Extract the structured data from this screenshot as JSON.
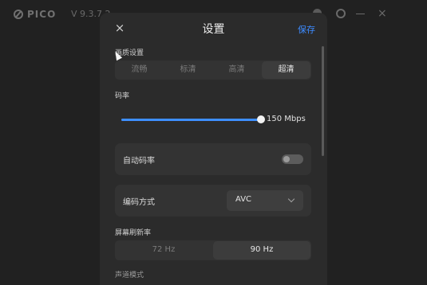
{
  "app": {
    "logo_text": "PICO",
    "version": "V 9.3.7.2"
  },
  "dialog": {
    "close_glyph": "×",
    "title": "设置",
    "save_label": "保存",
    "quality": {
      "label": "画质设置",
      "options": [
        "流畅",
        "标清",
        "高清",
        "超清"
      ],
      "selected": "超清"
    },
    "bitrate": {
      "label": "码率",
      "value_text": "150 Mbps",
      "fraction": 1.0
    },
    "auto_bitrate": {
      "label": "自动码率",
      "enabled": false
    },
    "encoding": {
      "label": "编码方式",
      "value": "AVC"
    },
    "refresh": {
      "label": "屏幕刷新率",
      "options": [
        "72 Hz",
        "90 Hz"
      ],
      "selected": "90 Hz"
    },
    "next_section_label": "声道模式"
  },
  "colors": {
    "accent": "#3e8fff",
    "dialog_bg": "#2b2b2b",
    "card_bg": "#333333"
  }
}
